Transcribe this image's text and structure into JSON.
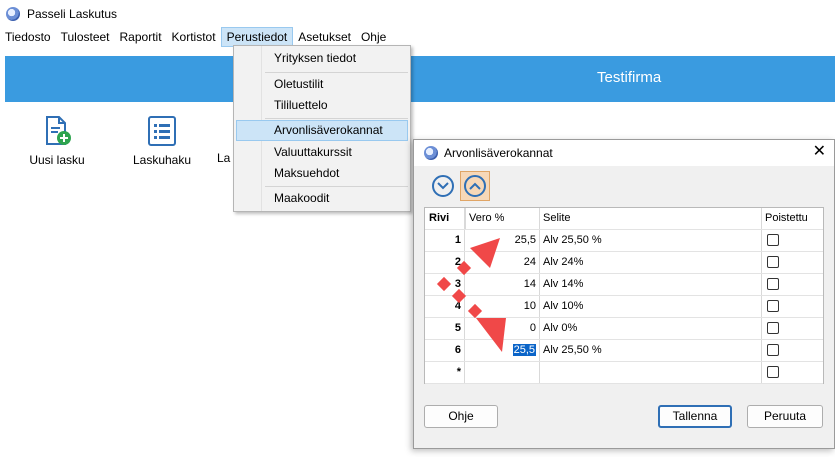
{
  "window": {
    "title": "Passeli Laskutus"
  },
  "menubar": {
    "items": [
      "Tiedosto",
      "Tulosteet",
      "Raportit",
      "Kortistot",
      "Perustiedot",
      "Asetukset",
      "Ohje"
    ]
  },
  "banner": {
    "company": "Testifirma"
  },
  "toolbar": {
    "new_invoice": "Uusi lasku",
    "invoice_search": "Laskuhaku",
    "third_partial": "La"
  },
  "dropdown": {
    "items": [
      "Yrityksen tiedot",
      "Oletustilit",
      "Tililuettelo",
      "Arvonlisäverokannat",
      "Valuuttakurssit",
      "Maksuehdot",
      "Maakoodit"
    ]
  },
  "dialog": {
    "title": "Arvonlisäverokannat",
    "close": "✕",
    "columns": {
      "row": "Rivi",
      "rate": "Vero %",
      "desc": "Selite",
      "deleted": "Poistettu"
    },
    "rows": [
      {
        "n": "1",
        "rate": "25,5",
        "desc": "Alv 25,50 %"
      },
      {
        "n": "2",
        "rate": "24",
        "desc": "Alv 24%"
      },
      {
        "n": "3",
        "rate": "14",
        "desc": "Alv 14%"
      },
      {
        "n": "4",
        "rate": "10",
        "desc": "Alv 10%"
      },
      {
        "n": "5",
        "rate": "0",
        "desc": "Alv 0%"
      },
      {
        "n": "6",
        "rate": "25,5",
        "desc": "Alv 25,50 %"
      }
    ],
    "new_row_marker": "*",
    "buttons": {
      "help": "Ohje",
      "save": "Tallenna",
      "cancel": "Peruuta"
    }
  },
  "colors": {
    "banner": "#3a9be0",
    "highlight": "#cce4f7",
    "arrow": "#f04848",
    "accent": "#2f6fb5"
  }
}
